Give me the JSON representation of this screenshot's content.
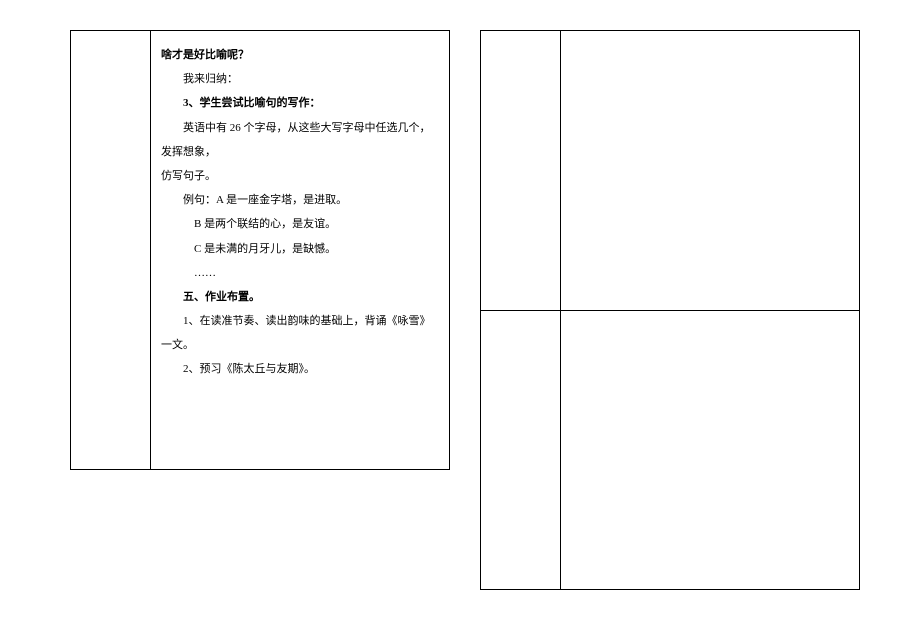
{
  "left": {
    "line1": "啥才是好比喻呢？",
    "line2": "我来归纳：",
    "line3": "3、学生尝试比喻句的写作：",
    "line4": "英语中有 26 个字母，从这些大写字母中任选几个，发挥想象，",
    "line5": "仿写句子。",
    "line6": "例句：A 是一座金字塔，是进取。",
    "line7": "B 是两个联结的心，是友谊。",
    "line8": "C 是未满的月牙儿，是缺憾。",
    "line9": "……",
    "line10": "五、作业布置。",
    "line11": "1、在读准节奏、读出韵味的基础上，背诵《咏雪》一文。",
    "line12": "2、预习《陈太丘与友期》。"
  }
}
